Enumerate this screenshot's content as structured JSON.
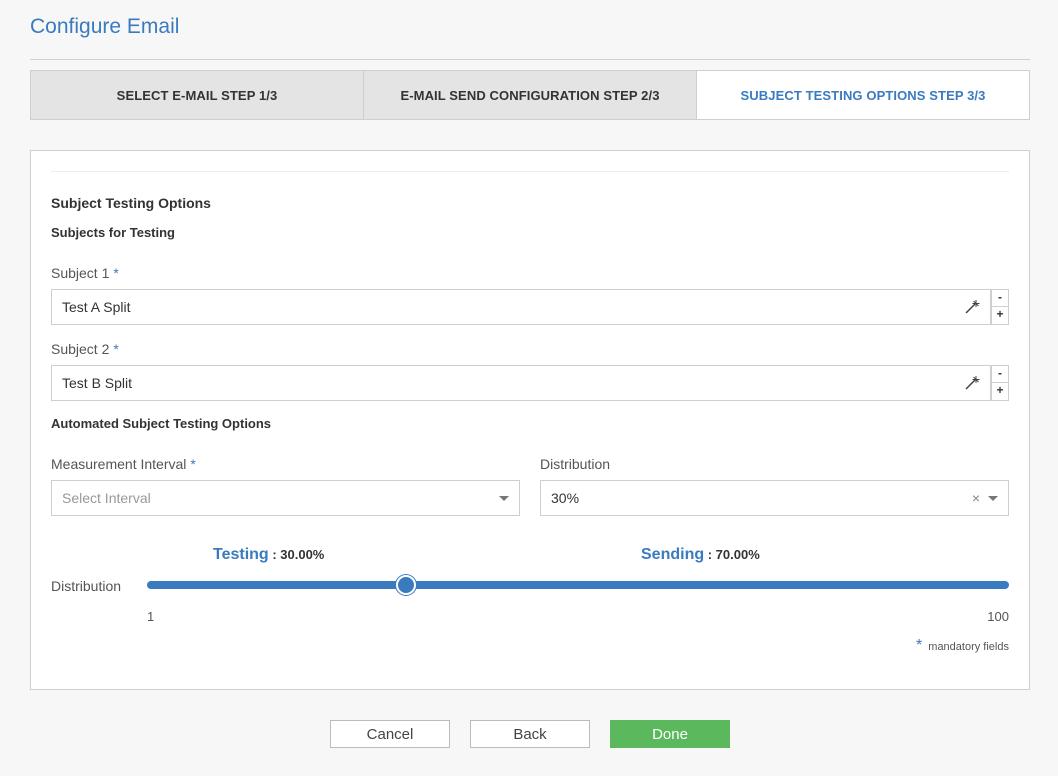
{
  "page": {
    "title": "Configure Email"
  },
  "tabs": [
    {
      "label": "SELECT E-MAIL STEP 1/3",
      "active": false
    },
    {
      "label": "E-MAIL SEND CONFIGURATION STEP 2/3",
      "active": false
    },
    {
      "label": "SUBJECT TESTING OPTIONS STEP 3/3",
      "active": true
    }
  ],
  "form": {
    "section_title": "Subject Testing Options",
    "subsection_title": "Subjects for Testing",
    "required_marker": "*",
    "subject1": {
      "label": "Subject 1",
      "value": "Test A Split"
    },
    "subject2": {
      "label": "Subject 2",
      "value": "Test B Split"
    },
    "stepper": {
      "minus": "-",
      "plus": "+"
    },
    "auto_title": "Automated Subject Testing Options",
    "interval": {
      "label": "Measurement Interval",
      "placeholder": "Select Interval"
    },
    "distribution_select": {
      "label": "Distribution",
      "value": "30%",
      "clear": "×"
    }
  },
  "slider": {
    "label": "Distribution",
    "testing_label": "Testing",
    "testing_value": ": 30.00%",
    "sending_label": "Sending",
    "sending_value": ": 70.00%",
    "min": "1",
    "max": "100",
    "value_fraction": 0.3
  },
  "footer": {
    "mandatory_text": "mandatory fields",
    "cancel": "Cancel",
    "back": "Back",
    "done": "Done"
  },
  "colors": {
    "accent": "#3a7bbf",
    "done": "#5cb85c"
  }
}
